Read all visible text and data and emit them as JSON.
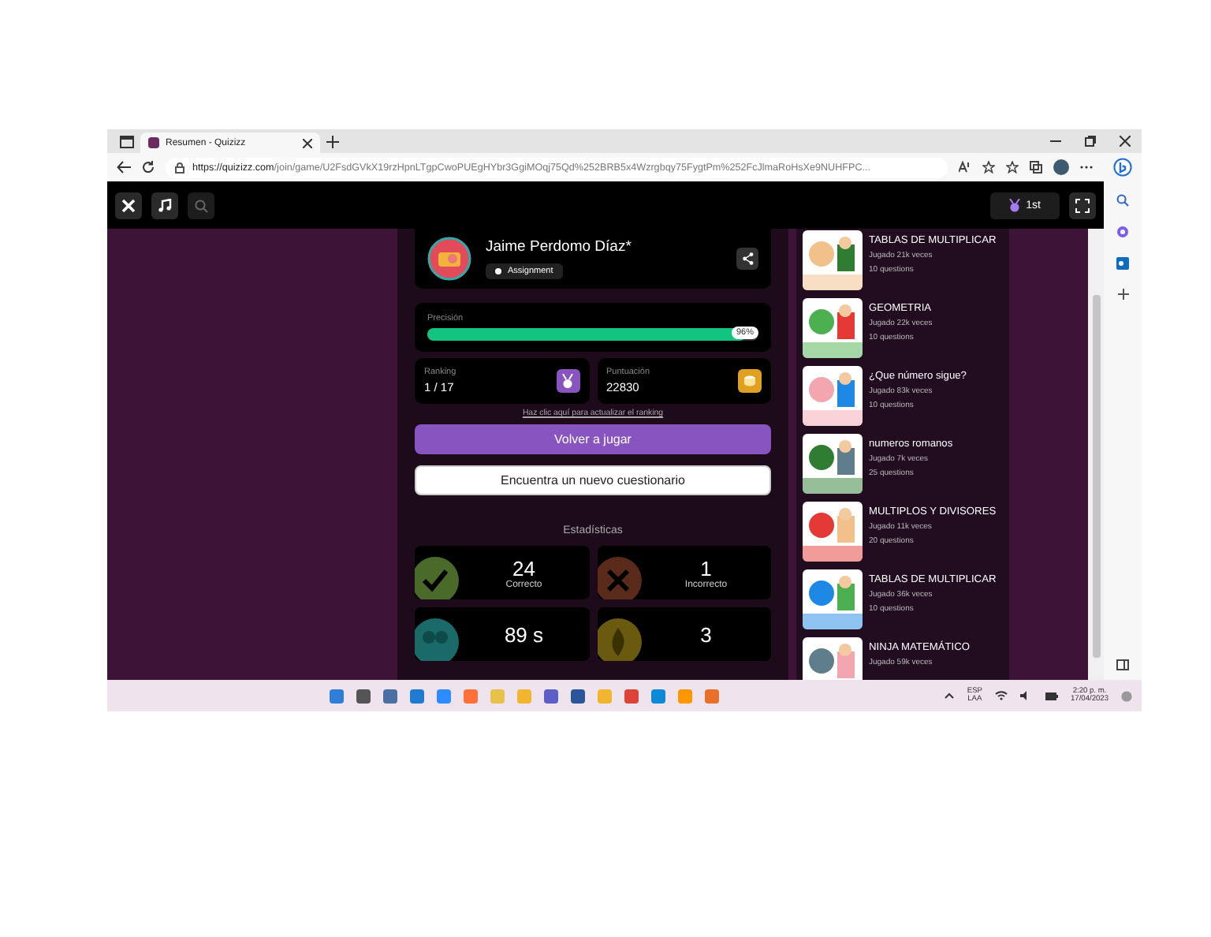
{
  "browser": {
    "tab_title": "Resumen - Quizizz",
    "url_host": "https://quizizz.com",
    "url_path": "/join/game/U2FsdGVkX19rzHpnLTgpCwoPUEgHYbr3GgiMOqj75Qd%252BRB5x4Wzrgbqy75FygtPm%252FcJlmaRoHsXe9NUHFPC..."
  },
  "quiz_header": {
    "rank": "1st"
  },
  "profile": {
    "name": "Jaime Perdomo Díaz*",
    "tag": "Assignment"
  },
  "precision": {
    "label": "Precisión",
    "level": 0.96,
    "reading": "96%"
  },
  "ranking": {
    "label": "Ranking",
    "value": "1 / 17"
  },
  "score": {
    "label": "Puntuación",
    "value": "22830"
  },
  "update_link": "Haz clic aquí para actualizar el ranking",
  "buttons": {
    "primary": "Volver a jugar",
    "secondary": "Encuentra un nuevo cuestionario"
  },
  "stats_title": "Estadísticas",
  "stats": [
    {
      "kind": "correct",
      "value": "24",
      "label": "Correcto"
    },
    {
      "kind": "incorrect",
      "value": "1",
      "label": "Incorrecto"
    },
    {
      "kind": "time",
      "value": "89 s"
    },
    {
      "kind": "streak",
      "value": "3"
    }
  ],
  "quizzes": [
    {
      "title": "TABLAS DE MULTIPLICAR",
      "plays": "Jugado 21k veces",
      "questions": "10 questions"
    },
    {
      "title": "GEOMETRIA",
      "plays": "Jugado 22k veces",
      "questions": "10 questions"
    },
    {
      "title": "¿Que número sigue?",
      "plays": "Jugado 83k veces",
      "questions": "10 questions"
    },
    {
      "title": "numeros romanos",
      "plays": "Jugado 7k veces",
      "questions": "25 questions"
    },
    {
      "title": "MULTIPLOS Y DIVISORES",
      "plays": "Jugado 11k veces",
      "questions": "20 questions"
    },
    {
      "title": "TABLAS DE MULTIPLICAR",
      "plays": "Jugado 36k veces",
      "questions": "10 questions"
    },
    {
      "title": "NINJA MATEMÁTICO",
      "plays": "Jugado 59k veces"
    }
  ],
  "taskbar": {
    "language": "ESP",
    "layout": "LAA",
    "time": "2:20 p. m.",
    "date": "17/04/2023"
  }
}
